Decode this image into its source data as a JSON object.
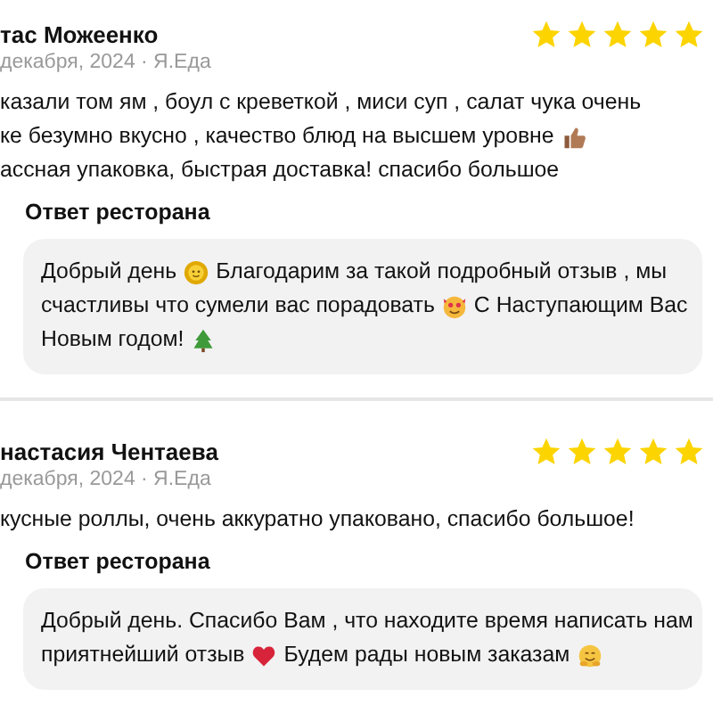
{
  "reviews": [
    {
      "author": "тас Можеенко",
      "stars": 5,
      "meta": "декабря, 2024 · Я.Еда",
      "lines": [
        [
          {
            "kind": "text",
            "text": "казали том ям , боул с креветкой , миси суп , салат чука очень"
          }
        ],
        [
          {
            "kind": "text",
            "text": "ке безумно вкусно , качество блюд на высшем уровне"
          },
          {
            "kind": "thumbs"
          }
        ],
        [
          {
            "kind": "text",
            "text": "ассная упаковка, быстрая доставка! спасибо большое"
          }
        ]
      ],
      "reply": {
        "label": "Ответ ресторана",
        "lines": [
          [
            {
              "kind": "text",
              "text": "Добрый день"
            },
            {
              "kind": "sun"
            },
            {
              "kind": "text",
              "text": "Благодарим за такой подробный отзыв , мы"
            }
          ],
          [
            {
              "kind": "text",
              "text": "счастливы что сумели вас порадовать"
            },
            {
              "kind": "hearts"
            },
            {
              "kind": "text",
              "text": "С Наступающим Вас"
            }
          ],
          [
            {
              "kind": "text",
              "text": "Новым годом!"
            },
            {
              "kind": "tree"
            }
          ]
        ]
      }
    },
    {
      "author": "настасия Чентаева",
      "stars": 5,
      "meta": "декабря, 2024 · Я.Еда",
      "lines": [
        [
          {
            "kind": "text",
            "text": "кусные роллы, очень аккуратно упаковано, спасибо большое!"
          }
        ]
      ],
      "reply": {
        "label": "Ответ ресторана",
        "lines": [
          [
            {
              "kind": "text",
              "text": "Добрый день. Спасибо Вам , что находите время написать нам"
            }
          ],
          [
            {
              "kind": "text",
              "text": "приятнейший отзыв"
            },
            {
              "kind": "heart"
            },
            {
              "kind": "text",
              "text": "Будем рады новым заказам"
            },
            {
              "kind": "hug"
            }
          ]
        ]
      }
    }
  ]
}
